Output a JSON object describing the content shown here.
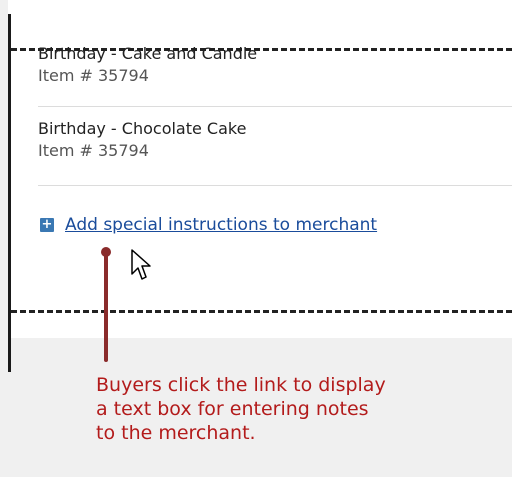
{
  "items": [
    {
      "name": "Birthday - Cake and Candle",
      "number": "Item # 35794"
    },
    {
      "name": "Birthday - Chocolate Cake",
      "number": "Item # 35794"
    }
  ],
  "special_instructions": {
    "expand_icon": "plus-box-icon",
    "link_label": "Add special instructions to merchant"
  },
  "pointer": {
    "icon": "arrow-cursor-icon"
  },
  "callout": {
    "text": "Buyers click the link to display\na text box for entering notes\nto the merchant.",
    "color": "#b31b1b"
  }
}
